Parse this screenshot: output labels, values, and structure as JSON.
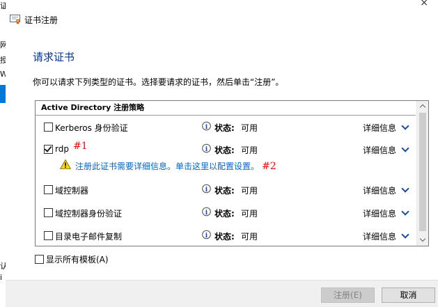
{
  "background": {
    "fragments": [
      "证",
      "网",
      "授",
      "W",
      "认",
      "i"
    ]
  },
  "window": {
    "title": "证书注册",
    "close_glyph": "×"
  },
  "page": {
    "heading": "请求证书",
    "description": "你可以请求下列类型的证书。选择要请求的证书，然后单击“注册”。"
  },
  "list": {
    "group_header": "Active Directory 注册策略",
    "status_label": "状态:",
    "details_label": "详细信息",
    "rows": [
      {
        "label": "Kerberos 身份验证",
        "status": "可用",
        "checked": false
      },
      {
        "label": "rdp",
        "status": "可用",
        "checked": true
      },
      {
        "label": "域控制器",
        "status": "可用",
        "checked": false
      },
      {
        "label": "域控制器身份验证",
        "status": "可用",
        "checked": false
      },
      {
        "label": "目录电子邮件复制",
        "status": "可用",
        "checked": false
      }
    ],
    "warning_link": "注册此证书需要详细信息。单击这里以配置设置。"
  },
  "annotations": {
    "mark1": "#1",
    "mark2": "#2"
  },
  "options": {
    "show_all_templates": "显示所有模板(A)",
    "show_all_checked": false
  },
  "buttons": {
    "register": "注册(E)",
    "cancel": "取消"
  },
  "colors": {
    "heading": "#003399",
    "link": "#0066cc",
    "annotation": "#ff0000",
    "warning": "#ffd700"
  }
}
